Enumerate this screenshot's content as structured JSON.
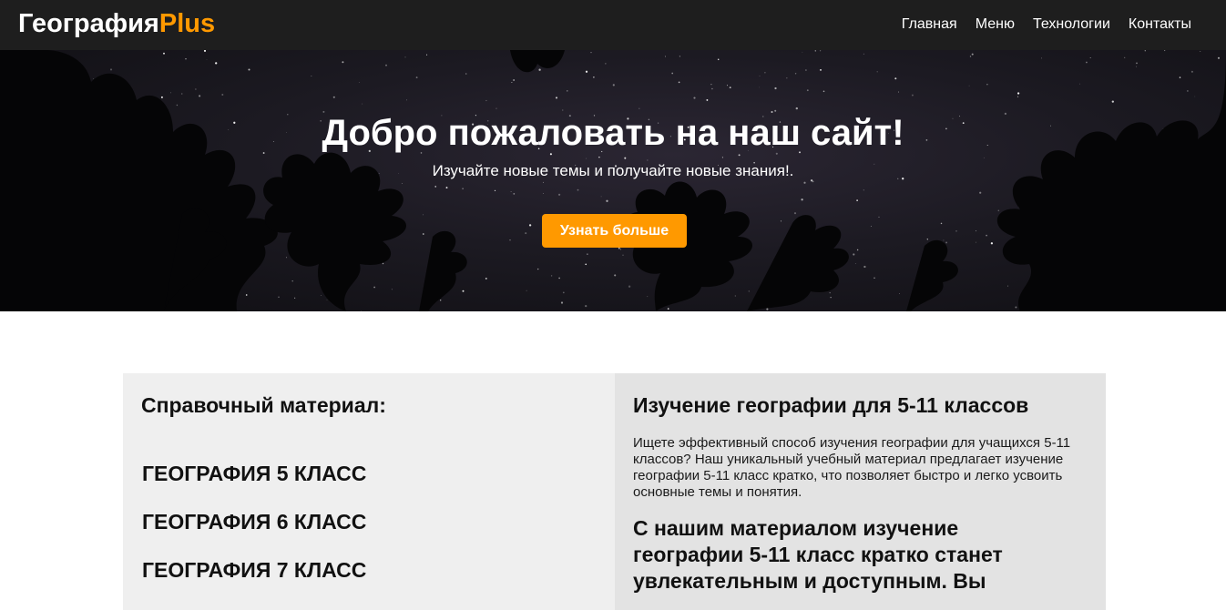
{
  "header": {
    "logo_main": "География",
    "logo_accent": "Plus",
    "nav": [
      "Главная",
      "Меню",
      "Технологии",
      "Контакты"
    ]
  },
  "hero": {
    "title": "Добро пожаловать на наш сайт!",
    "subtitle": "Изучайте новые темы и получайте новые знания!.",
    "button_label": "Узнать больше"
  },
  "reference": {
    "heading": "Справочный материал:",
    "grades": [
      "ГЕОГРАФИЯ 5 КЛАСС",
      "ГЕОГРАФИЯ 6 КЛАСС",
      "ГЕОГРАФИЯ 7 КЛАСС"
    ]
  },
  "study": {
    "heading": "Изучение географии для 5-11 классов",
    "paragraph": "Ищете эффективный способ изучения географии для учащихся 5-11 классов? Наш уникальный учебный материал предлагает изучение географии 5-11 класс кратко, что позволяет быстро и легко усвоить основные темы и понятия.",
    "subheading": "С нашим материалом изучение географии 5-11 класс кратко станет увлекательным и доступным. Вы"
  },
  "colors": {
    "accent": "#ff9900",
    "navbar": "#1e1e1e",
    "panel_left": "#efefef",
    "panel_right": "#e3e3e3"
  }
}
